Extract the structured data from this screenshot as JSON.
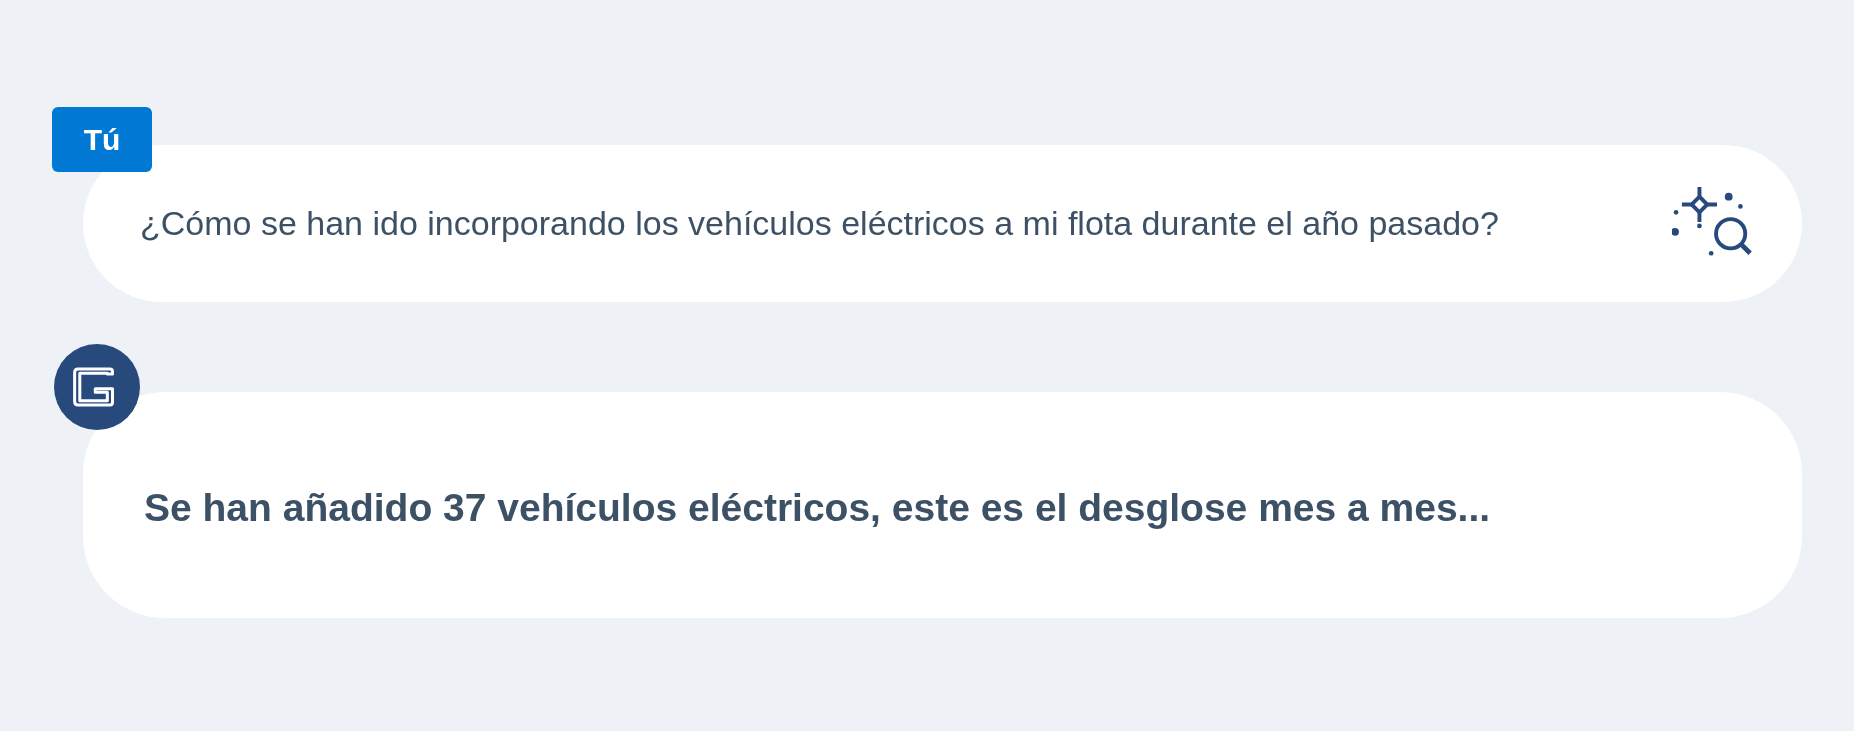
{
  "messages": [
    {
      "kind": "user",
      "author": "Tú",
      "text": "¿Cómo se han ido incorporando los vehículos eléctricos a mi flota durante el año pasado?"
    },
    {
      "kind": "assistant",
      "text": "Se han añadido 37 vehículos eléctricos, este es el desglose mes a mes..."
    }
  ]
}
